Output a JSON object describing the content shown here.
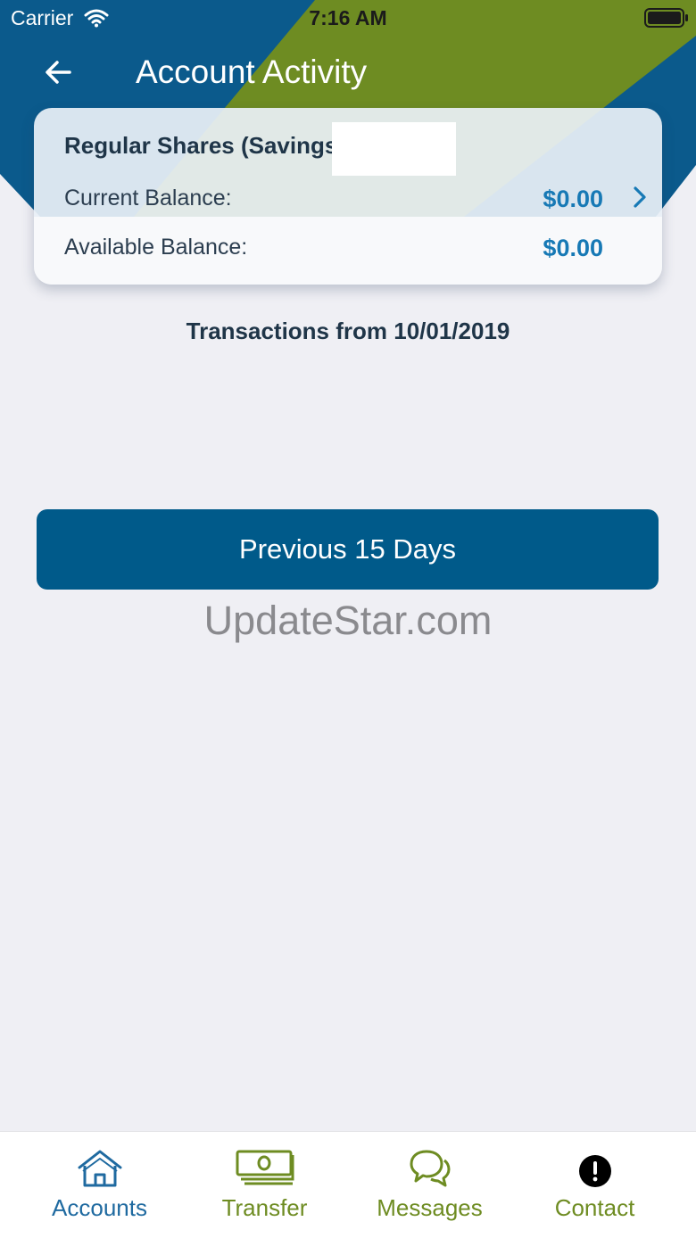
{
  "status_bar": {
    "carrier": "Carrier",
    "time": "7:16 AM",
    "icons": [
      "wifi-icon",
      "battery-icon"
    ]
  },
  "header": {
    "title": "Account Activity",
    "back_icon": "arrow-left-icon",
    "colors": {
      "blue": "#0b5a8c",
      "green": "#6e8c22"
    }
  },
  "account": {
    "name": "Regular Shares (Savings)",
    "current_label": "Current Balance:",
    "current_value": "$0.00",
    "available_label": "Available Balance:",
    "available_value": "$0.00"
  },
  "transactions": {
    "heading": "Transactions from 10/01/2019"
  },
  "actions": {
    "previous_label": "Previous 15 Days"
  },
  "watermark": "UpdateStar.com",
  "tabs": [
    {
      "label": "Accounts",
      "icon": "home-icon",
      "color": "#1f6aa0"
    },
    {
      "label": "Transfer",
      "icon": "cash-icon",
      "color": "#6e8c22"
    },
    {
      "label": "Messages",
      "icon": "chat-bubbles-icon",
      "color": "#6e8c22"
    },
    {
      "label": "Contact",
      "icon": "alert-circle-icon",
      "color": "#6e8c22"
    }
  ]
}
